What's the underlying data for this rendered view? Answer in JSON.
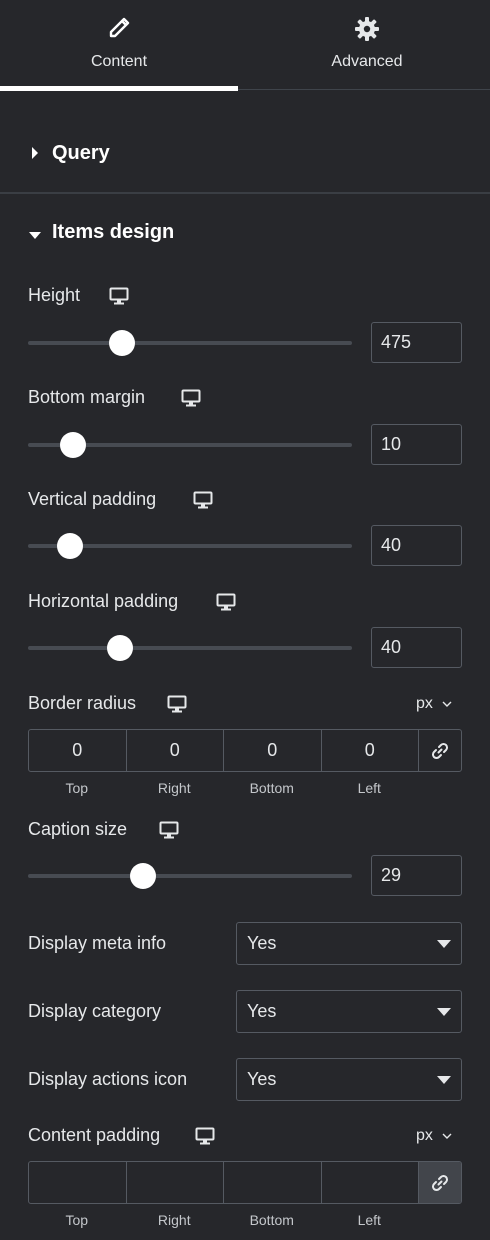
{
  "tabs": {
    "content": {
      "label": "Content",
      "icon": "pencil-icon",
      "active": true
    },
    "advanced": {
      "label": "Advanced",
      "icon": "gear-icon"
    }
  },
  "sections": {
    "query": {
      "title": "Query",
      "expanded": false
    },
    "items_design": {
      "title": "Items design",
      "expanded": true
    }
  },
  "controls": {
    "height": {
      "label": "Height",
      "value": "475",
      "slider_fraction": 0.29
    },
    "bottom_margin": {
      "label": "Bottom margin",
      "value": "10",
      "slider_fraction": 0.14
    },
    "vertical_padding": {
      "label": "Vertical padding",
      "value": "40",
      "slider_fraction": 0.13
    },
    "horizontal_padding": {
      "label": "Horizontal padding",
      "value": "40",
      "slider_fraction": 0.285
    },
    "border_radius": {
      "label": "Border radius",
      "unit": "px",
      "values": {
        "top": "0",
        "right": "0",
        "bottom": "0",
        "left": "0"
      },
      "labels": {
        "top": "Top",
        "right": "Right",
        "bottom": "Bottom",
        "left": "Left"
      }
    },
    "caption_size": {
      "label": "Caption size",
      "value": "29",
      "slider_fraction": 0.355
    },
    "display_meta_info": {
      "label": "Display meta info",
      "value": "Yes"
    },
    "display_category": {
      "label": "Display category",
      "value": "Yes"
    },
    "display_actions_icon": {
      "label": "Display actions icon",
      "value": "Yes"
    },
    "content_padding": {
      "label": "Content padding",
      "unit": "px",
      "values": {
        "top": "",
        "right": "",
        "bottom": "",
        "left": ""
      },
      "labels": {
        "top": "Top",
        "right": "Right",
        "bottom": "Bottom",
        "left": "Left"
      }
    }
  },
  "colors": {
    "panel_bg": "#26272b",
    "text": "#e6e8ea",
    "slider_track": "#474b52",
    "slider_thumb": "#ffffff",
    "border": "#555a62"
  }
}
